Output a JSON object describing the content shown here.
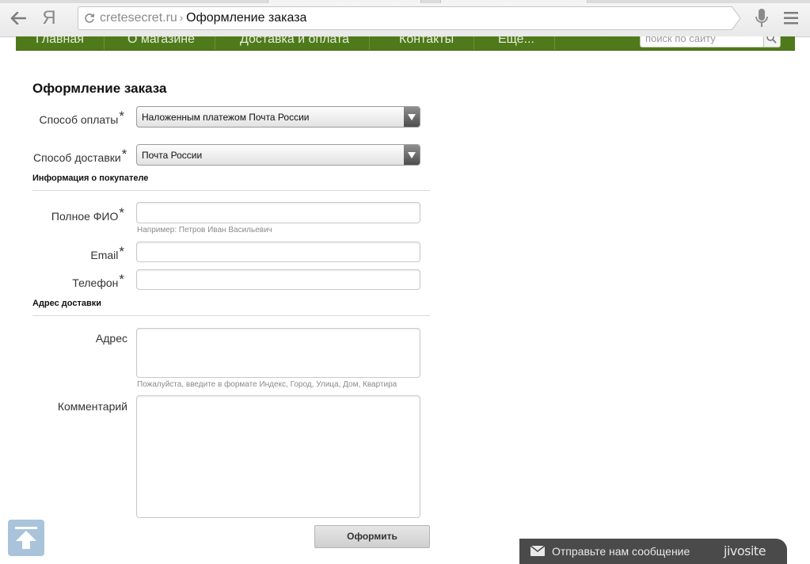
{
  "browser": {
    "logo": "Я",
    "url_domain": "cretesecret.ru",
    "url_separator": "›",
    "page_title": "Оформление заказа"
  },
  "site_nav": {
    "items": [
      "Главная",
      "О магазине",
      "Доставка и оплата",
      "Контакты",
      "Еще..."
    ],
    "search_placeholder": "поиск по сайту"
  },
  "form": {
    "title": "Оформление заказа",
    "required_mark": "*",
    "payment": {
      "label": "Способ оплаты",
      "value": "Наложенным платежом Почта России"
    },
    "delivery": {
      "label": "Способ доставки",
      "value": "Почта России"
    },
    "buyer_section": "Информация о покупателе",
    "full_name": {
      "label": "Полное ФИО",
      "value": "",
      "hint": "Например: Петров Иван Васильевич"
    },
    "email": {
      "label": "Email",
      "value": ""
    },
    "phone": {
      "label": "Телефон",
      "value": ""
    },
    "address_section": "Адрес доставки",
    "address": {
      "label": "Адрес",
      "value": "",
      "hint": "Пожалуйста, введите в формате Индекс, Город, Улица, Дом, Квартира"
    },
    "comment": {
      "label": "Комментарий",
      "value": ""
    },
    "submit_label": "Оформить"
  },
  "chat_widget": {
    "text": "Отправьте нам сообщение",
    "brand": "jivosite"
  },
  "colors": {
    "nav_green": "#4f7a1c",
    "chat_bg": "#4a4a4a",
    "scroll_top_bg": "#a9c4da"
  }
}
